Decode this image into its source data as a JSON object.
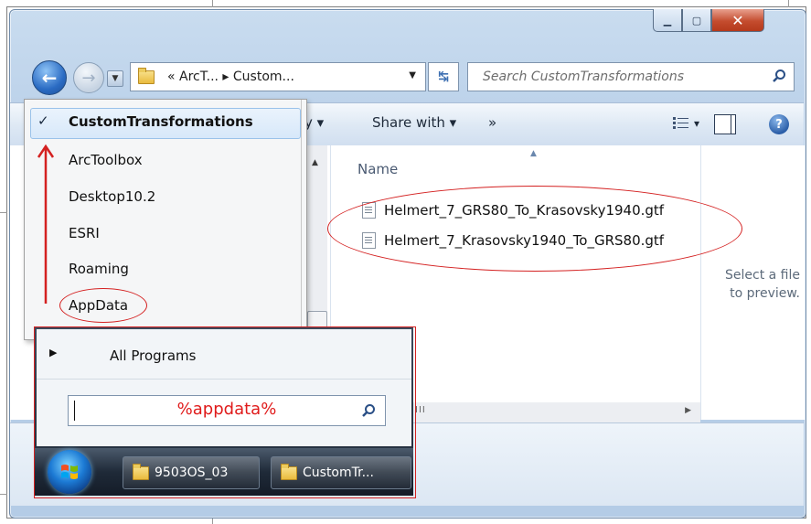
{
  "address": {
    "crumbs": "« ArcT... ▸ Custom...",
    "dropdown_icon": "chevron-down-icon"
  },
  "search": {
    "placeholder": "Search CustomTransformations"
  },
  "toolbar": {
    "partial_label": "y ▾",
    "share_with": "Share with ▾",
    "more": "»",
    "view_arrow": "▾",
    "help": "?"
  },
  "history_menu": {
    "check": "✓",
    "items": [
      {
        "label": "CustomTransformations",
        "selected": true
      },
      {
        "label": "ArcToolbox"
      },
      {
        "label": "Desktop10.2"
      },
      {
        "label": "ESRI"
      },
      {
        "label": "Roaming"
      },
      {
        "label": "AppData"
      }
    ]
  },
  "file_list": {
    "header": "Name",
    "files": [
      "Helmert_7_GRS80_To_Krasovsky1940.gtf",
      "Helmert_7_Krasovsky1940_To_GRS80.gtf"
    ]
  },
  "preview": {
    "text_line1": "Select a file",
    "text_line2": "to preview."
  },
  "start_menu": {
    "all_programs": "All Programs",
    "search_value": "%appdata%"
  },
  "taskbar": {
    "buttons": [
      "9503OS_03",
      "CustomTr..."
    ]
  },
  "colors": {
    "annotation_red": "#d42121",
    "window_chrome": "#bcd2ea"
  }
}
